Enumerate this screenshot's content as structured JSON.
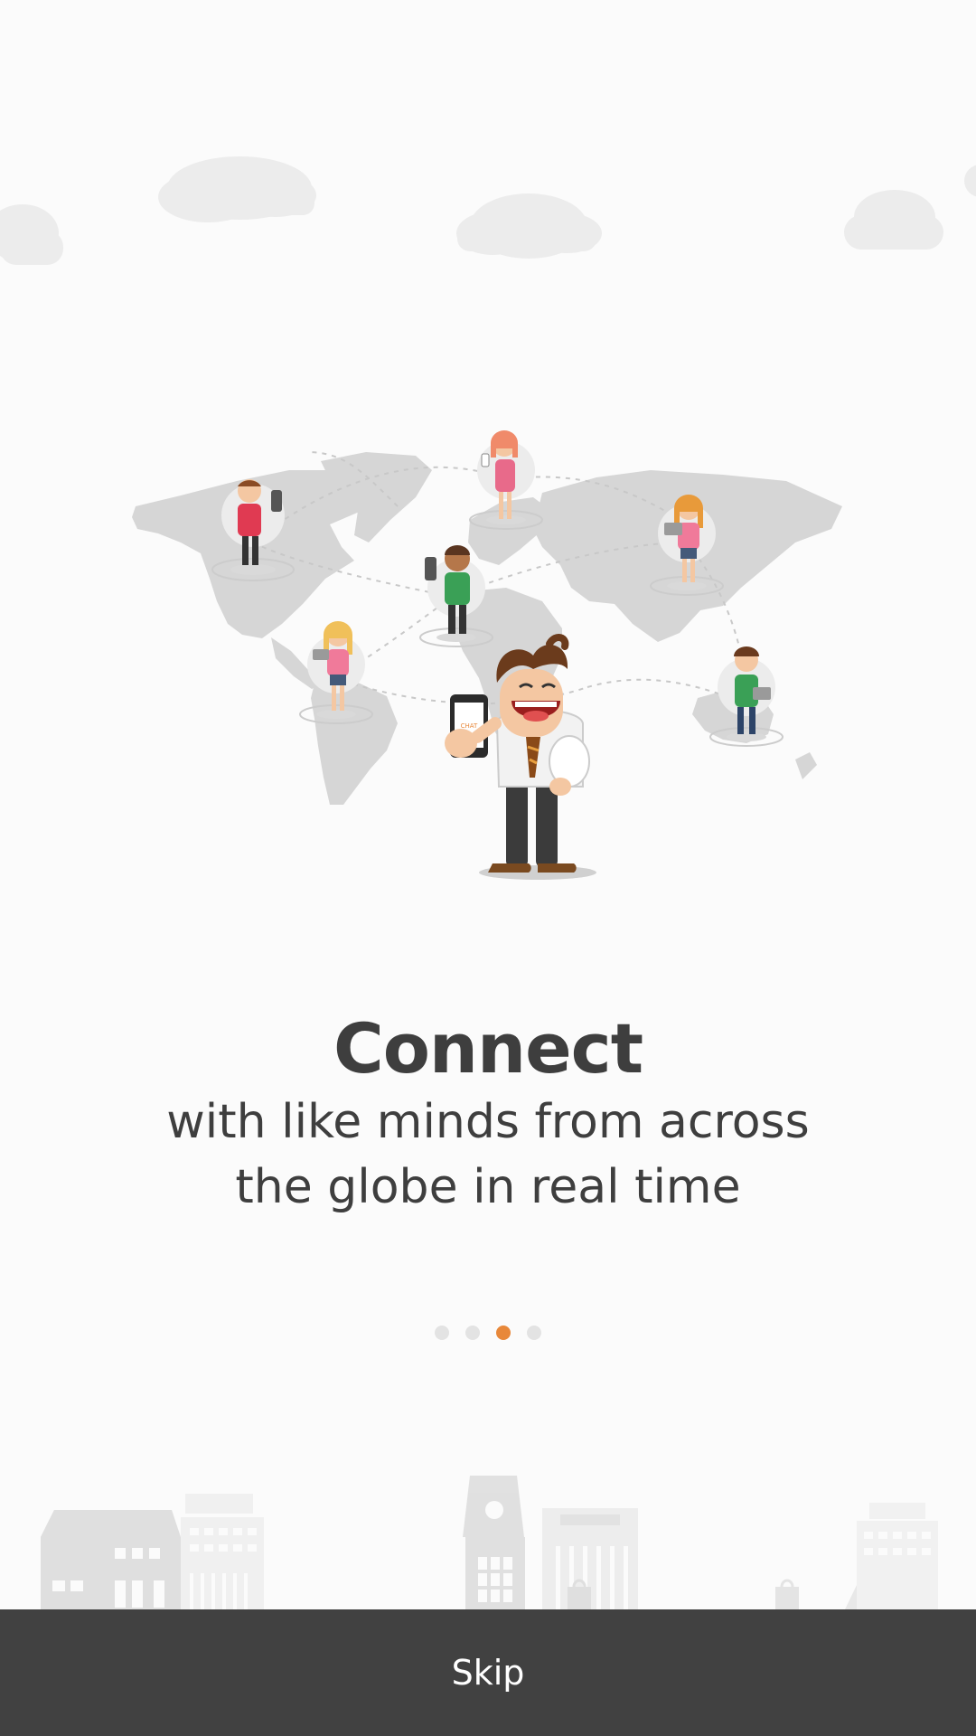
{
  "onboarding": {
    "title": "Connect",
    "subtitle_line1": "with like minds from across",
    "subtitle_line2": "the globe in real time",
    "total_pages": 4,
    "current_page": 3,
    "skip_label": "Skip"
  },
  "colors": {
    "background": "#fbfbfb",
    "text": "#3e3e3e",
    "accent": "#e8883a",
    "inactive_dot": "#e3e3e3",
    "skip_bar": "#414141",
    "skip_text": "#ffffff"
  },
  "illustration": {
    "mascot_phone_logo": "CHAT"
  }
}
